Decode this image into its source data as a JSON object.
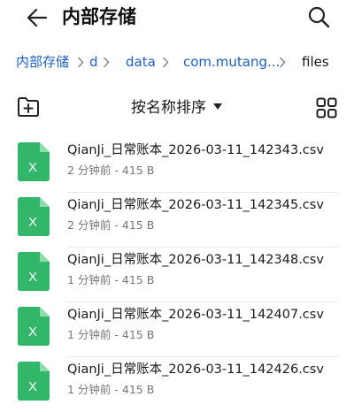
{
  "header": {
    "title": "内部存储"
  },
  "breadcrumbs": [
    {
      "label": "内部存储"
    },
    {
      "label": "d"
    },
    {
      "label": "data"
    },
    {
      "label": "com.mutang..."
    },
    {
      "label": "files"
    }
  ],
  "toolbar": {
    "sort_label": "按名称排序"
  },
  "files": [
    {
      "name": "QianJi_日常账本_2026-03-11_142343.csv",
      "meta": "2 分钟前 - 415 B"
    },
    {
      "name": "QianJi_日常账本_2026-03-11_142345.csv",
      "meta": "2 分钟前 - 415 B"
    },
    {
      "name": "QianJi_日常账本_2026-03-11_142348.csv",
      "meta": "1 分钟前 - 415 B"
    },
    {
      "name": "QianJi_日常账本_2026-03-11_142407.csv",
      "meta": "1 分钟前 - 415 B"
    },
    {
      "name": "QianJi_日常账本_2026-03-11_142426.csv",
      "meta": "1 分钟前 - 415 B"
    }
  ],
  "icons": {
    "back": "back-arrow-icon",
    "search": "search-icon",
    "new_folder": "new-folder-icon",
    "grid_view": "grid-view-icon",
    "file": "spreadsheet-file-icon",
    "file_letter": "X"
  },
  "colors": {
    "link": "#1d5fc9",
    "spreadsheet": "#31b66a",
    "spreadsheet_fold": "#8fdcab"
  }
}
